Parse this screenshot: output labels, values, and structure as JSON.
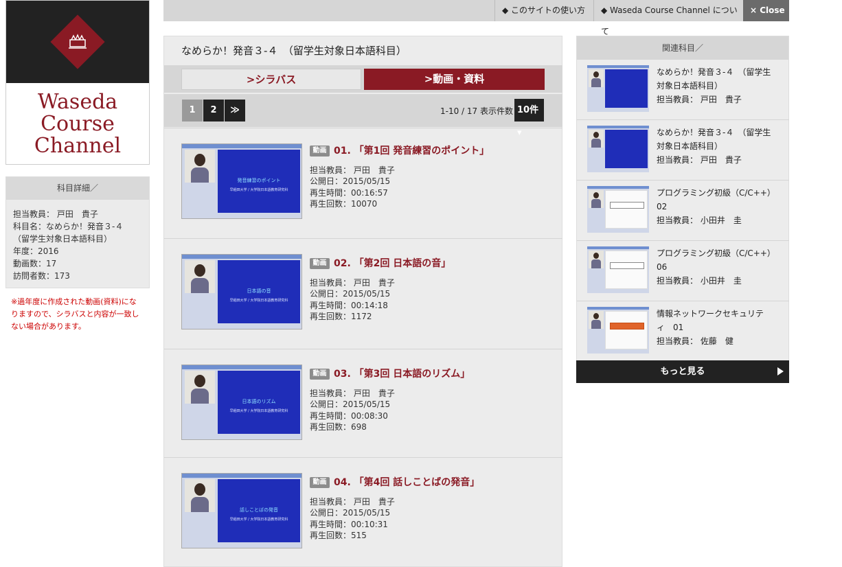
{
  "logo": {
    "line1": "Waseda",
    "line2": "Course",
    "line3": "Channel"
  },
  "details": {
    "heading": "科目詳細／",
    "lines": [
      "担当教員： 戸田　貴子",
      "科目名：なめらか！発音３-４",
      "（留学生対象日本語科目）",
      "年度：2016",
      "動画数：17",
      "訪問者数：173"
    ],
    "warning": "※過年度に作成された動画(資料)になりますので、シラバスと内容が一致しない場合があります。"
  },
  "topbar": {
    "how_to": "◆ このサイトの使い方",
    "about": "◆ Waseda Course Channel について",
    "close": "× Close"
  },
  "course": {
    "title": "なめらか！発音３-４　（留学生対象日本語科目）",
    "tab_syllabus": ">シラバス",
    "tab_videos": ">動画・資料"
  },
  "pager": {
    "pages": [
      "1",
      "2",
      "≫"
    ],
    "count": "1-10 / 17  表示件数",
    "per_page": "10件 ▾"
  },
  "videos": [
    {
      "badge": "動画",
      "number": "01.",
      "title": "「第1回 発音練習のポイント」",
      "slide_title": "発音練習のポイント",
      "slide_sub": "早稲田大学 / 大学院日本語教育研究科",
      "teacher": "担当教員： 戸田　貴子",
      "published": "公開日：2015/05/15",
      "duration": "再生時間：00:16:57",
      "views": "再生回数：10070"
    },
    {
      "badge": "動画",
      "number": "02.",
      "title": "「第2回 日本語の音」",
      "slide_title": "日本語の音",
      "slide_sub": "早稲田大学 / 大学院日本語教育研究科",
      "teacher": "担当教員： 戸田　貴子",
      "published": "公開日：2015/05/15",
      "duration": "再生時間：00:14:18",
      "views": "再生回数：1172"
    },
    {
      "badge": "動画",
      "number": "03.",
      "title": "「第3回 日本語のリズム」",
      "slide_title": "日本語のリズム",
      "slide_sub": "早稲田大学 / 大学院日本語教育研究科",
      "teacher": "担当教員： 戸田　貴子",
      "published": "公開日：2015/05/15",
      "duration": "再生時間：00:08:30",
      "views": "再生回数：698"
    },
    {
      "badge": "動画",
      "number": "04.",
      "title": "「第4回 話しことばの発音」",
      "slide_title": "話しことばの発音",
      "slide_sub": "早稲田大学 / 大学院日本語教育研究科",
      "teacher": "担当教員： 戸田　貴子",
      "published": "公開日：2015/05/15",
      "duration": "再生時間：00:10:31",
      "views": "再生回数：515"
    }
  ],
  "related": {
    "heading": "関連科目／",
    "items": [
      {
        "line1": "なめらか！発音３-４　（留学生",
        "line2": "対象日本語科目）",
        "teacher": "担当教員： 戸田　貴子"
      },
      {
        "line1": "なめらか！発音３-４　（留学生",
        "line2": "対象日本語科目）",
        "teacher": "担当教員： 戸田　貴子"
      },
      {
        "line1": "プログラミング初級（C/C++）",
        "line2": "02",
        "teacher": "担当教員： 小田井　圭"
      },
      {
        "line1": "プログラミング初級（C/C++）",
        "line2": "06",
        "teacher": "担当教員： 小田井　圭"
      },
      {
        "line1": "情報ネットワークセキュリテ",
        "line2": "ィ　01",
        "teacher": "担当教員： 佐藤　健"
      }
    ],
    "more": "もっと見る"
  },
  "colors": {
    "brand": "#8a1a24",
    "dark": "#222222",
    "panel": "#ececec"
  }
}
